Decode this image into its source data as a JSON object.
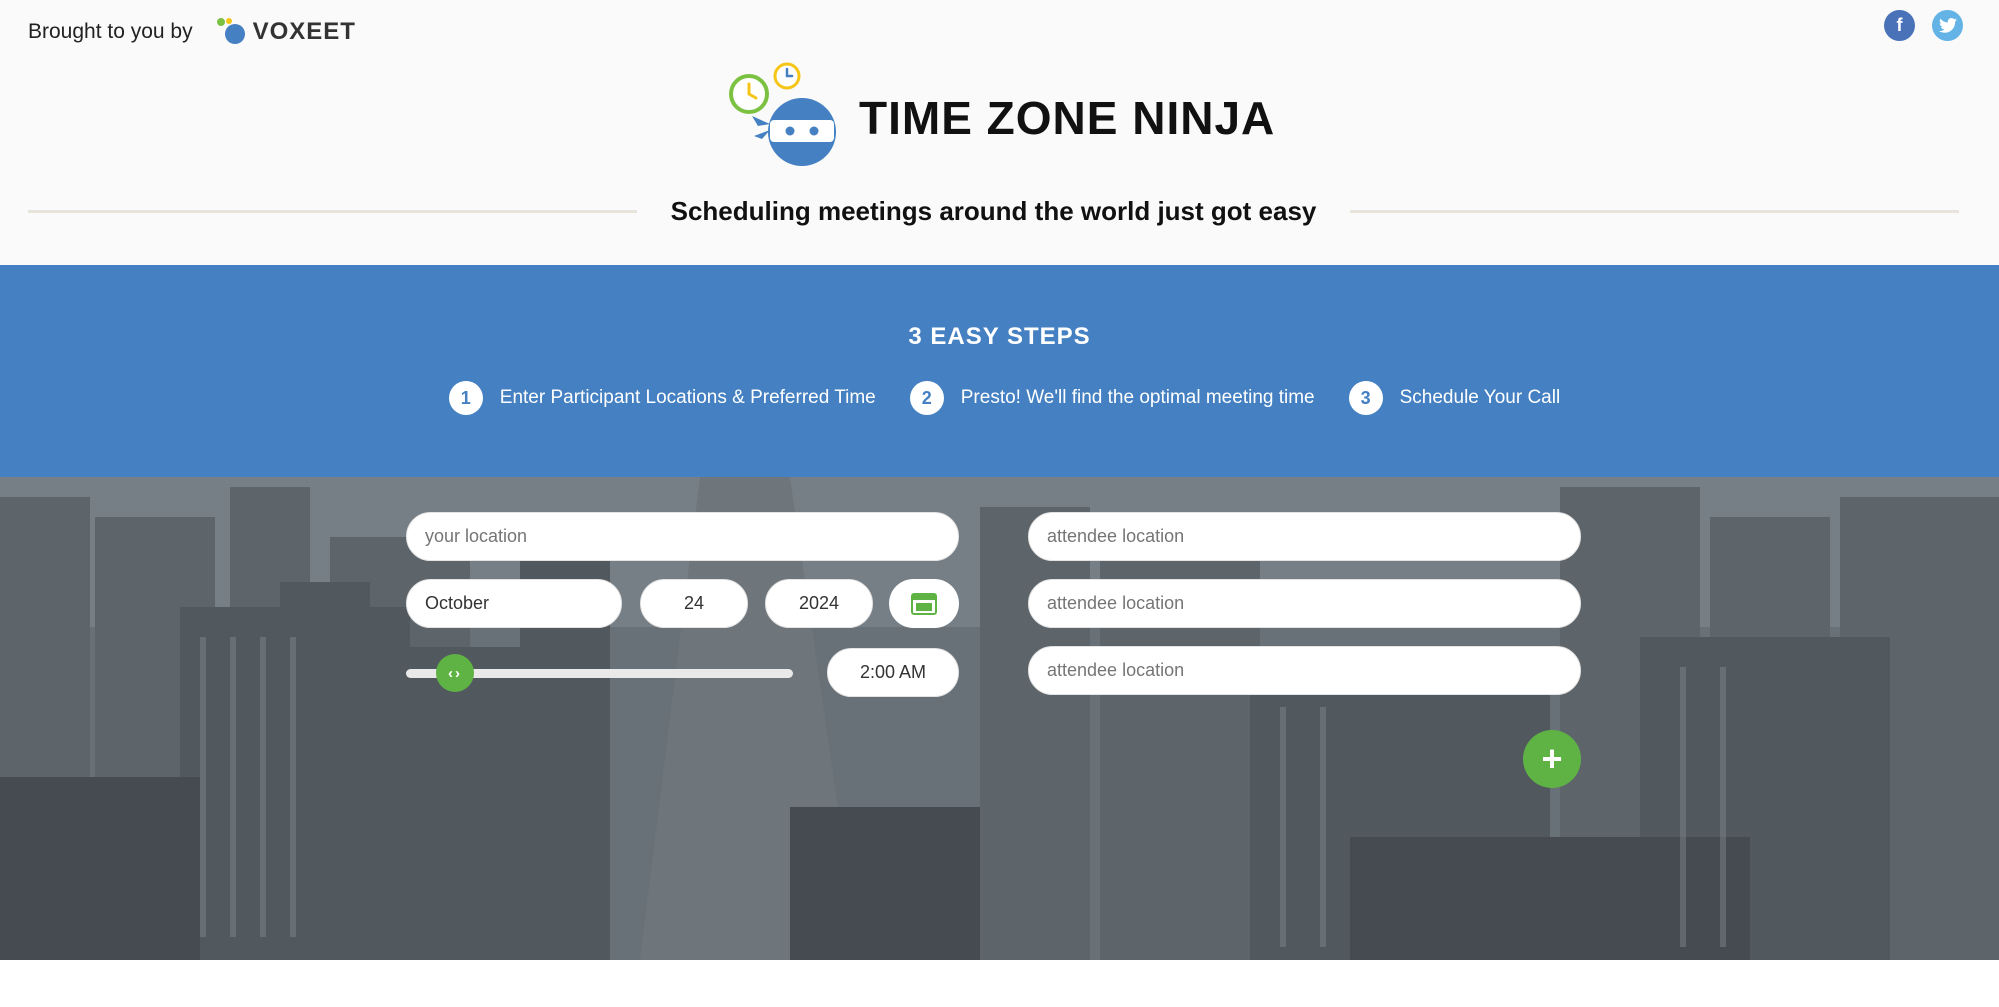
{
  "top": {
    "brought_label": "Brought to you by",
    "brand_name": "VOXEET",
    "social": {
      "facebook_glyph": "f",
      "twitter_glyph": "t"
    }
  },
  "header": {
    "title": "TIME ZONE NINJA",
    "tagline": "Scheduling meetings around the world just got easy"
  },
  "steps": {
    "title": "3 EASY STEPS",
    "items": [
      {
        "num": "1",
        "label": "Enter Participant Locations & Preferred Time"
      },
      {
        "num": "2",
        "label": "Presto! We'll find the optimal meeting time"
      },
      {
        "num": "3",
        "label": "Schedule Your Call"
      }
    ]
  },
  "form": {
    "your_location_placeholder": "your location",
    "month": "October",
    "day": "24",
    "year": "2024",
    "time": "2:00 AM",
    "slider_glyph": "‹›",
    "attendee_placeholder": "attendee location",
    "attendees": [
      "attendee location",
      "attendee location",
      "attendee location"
    ],
    "add_glyph": "+"
  },
  "colors": {
    "accent_blue": "#4480c2",
    "accent_green": "#5fb344",
    "facebook": "#4a72b8",
    "twitter": "#63b3e6"
  },
  "icons": [
    "voxeet-logo-icon",
    "facebook-icon",
    "twitter-icon",
    "ninja-logo-icon",
    "calendar-icon",
    "slider-arrows-icon",
    "plus-icon"
  ]
}
